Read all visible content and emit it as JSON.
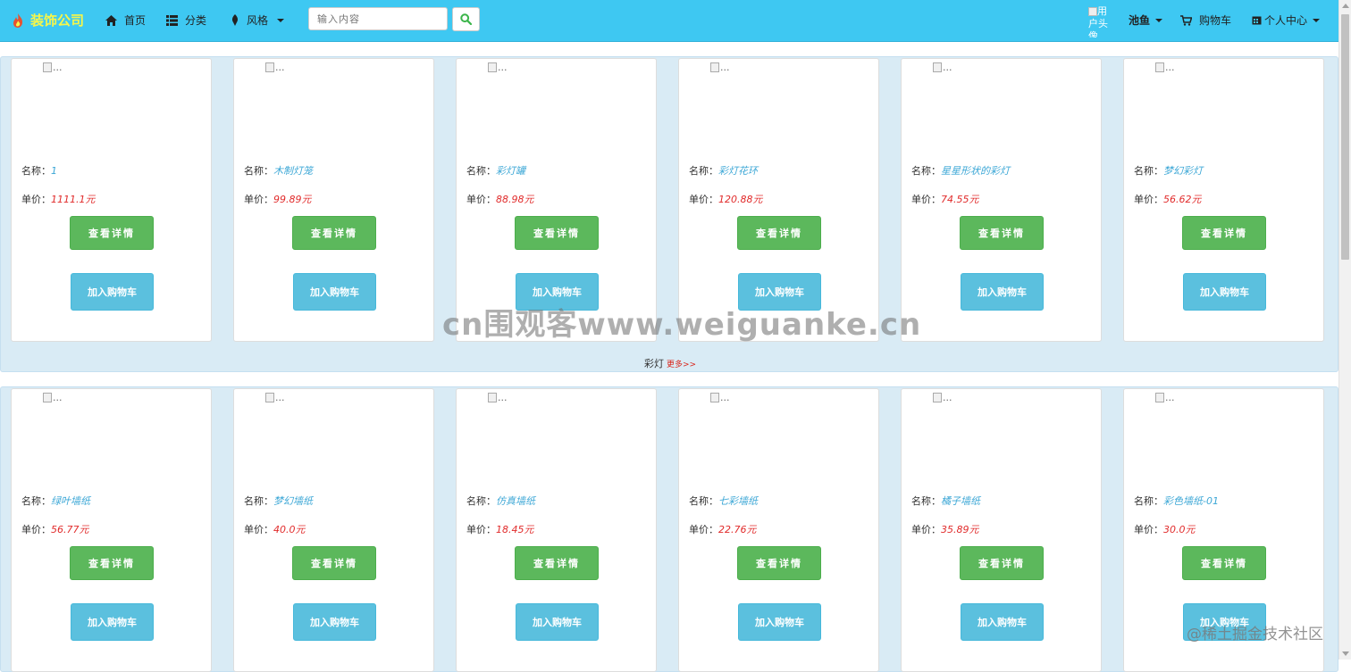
{
  "brand": {
    "name": "装饰公司"
  },
  "nav": {
    "home": "首页",
    "category": "分类",
    "style": "风格"
  },
  "search": {
    "placeholder": "输入内容"
  },
  "user": {
    "avatar_alt": "用户头像",
    "name": "池鱼",
    "cart": "购物车",
    "center": "个人中心"
  },
  "labels": {
    "name": "名称：",
    "price": "单价：",
    "detail": "查看详情",
    "add_cart": "加入购物车",
    "img_alt": "..."
  },
  "sections": [
    {
      "title": "彩灯",
      "more": "更多>>",
      "products": [
        {
          "name": "1",
          "price": "1111.1元"
        },
        {
          "name": "木制灯笼",
          "price": "99.89元"
        },
        {
          "name": "彩灯罐",
          "price": "88.98元"
        },
        {
          "name": "彩灯花环",
          "price": "120.88元"
        },
        {
          "name": "星星形状的彩灯",
          "price": "74.55元"
        },
        {
          "name": "梦幻彩灯",
          "price": "56.62元"
        }
      ]
    },
    {
      "title": "",
      "more": "",
      "products": [
        {
          "name": "绿叶墙纸",
          "price": "56.77元"
        },
        {
          "name": "梦幻墙纸",
          "price": "40.0元"
        },
        {
          "name": "仿真墙纸",
          "price": "18.45元"
        },
        {
          "name": "七彩墙纸",
          "price": "22.76元"
        },
        {
          "name": "橘子墙纸",
          "price": "35.89元"
        },
        {
          "name": "彩色墙纸-01",
          "price": "30.0元"
        }
      ]
    }
  ],
  "watermark": "cn围观客www.weiguanke.cn",
  "corner_watermark": "@稀土掘金技术社区",
  "colors": {
    "navbar": "#3ec8f2",
    "brand": "#f6f64a",
    "detail_button": "#5cb85c",
    "cart_button": "#5bc0de",
    "price": "#e12b2b",
    "name": "#3ca7d6"
  }
}
